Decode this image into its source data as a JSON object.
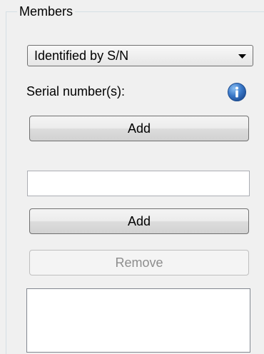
{
  "members_group": {
    "title": "Members",
    "dropdown": {
      "selected": "Identified by S/N"
    },
    "serial_label": "Serial number(s):",
    "add_button_top_label": "Add",
    "text_input": {
      "value": "",
      "placeholder": ""
    },
    "add_button_label": "Add",
    "remove_button_label": "Remove",
    "list_items": []
  },
  "icons": {
    "dropdown_arrow": "chevron-down-icon",
    "info": "info-icon"
  },
  "colors": {
    "info_icon_blue": "#3a78c8",
    "disabled_text": "#8d8d8d"
  }
}
